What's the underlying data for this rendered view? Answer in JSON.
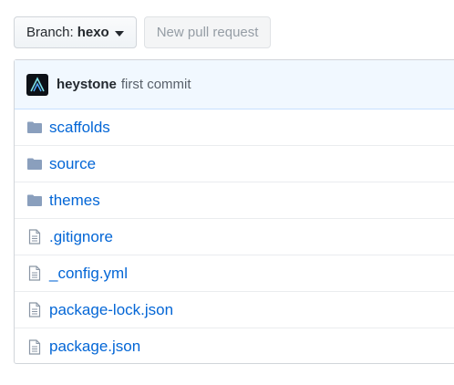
{
  "toolbar": {
    "branch_prefix": "Branch:",
    "branch_name": "hexo",
    "new_pr_label": "New pull request"
  },
  "commit": {
    "author": "heystone",
    "message": "first commit"
  },
  "colors": {
    "link": "#0366d6",
    "folder": "#79b8ff",
    "commit_bg": "#f1f8ff"
  },
  "files": [
    {
      "name": "scaffolds",
      "type": "folder",
      "icon": "folder-icon"
    },
    {
      "name": "source",
      "type": "folder",
      "icon": "folder-icon"
    },
    {
      "name": "themes",
      "type": "folder",
      "icon": "folder-icon"
    },
    {
      "name": ".gitignore",
      "type": "file",
      "icon": "file-icon"
    },
    {
      "name": "_config.yml",
      "type": "file",
      "icon": "file-icon"
    },
    {
      "name": "package-lock.json",
      "type": "file",
      "icon": "file-icon"
    },
    {
      "name": "package.json",
      "type": "file",
      "icon": "file-icon"
    }
  ]
}
